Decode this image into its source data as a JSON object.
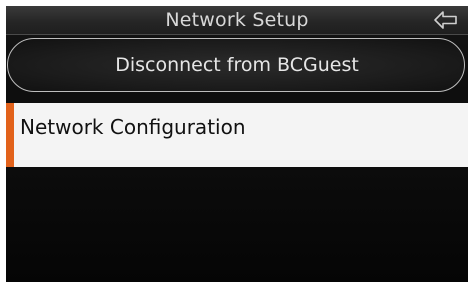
{
  "header": {
    "title": "Network Setup",
    "back_icon": "back-arrow-icon"
  },
  "actions": {
    "disconnect_label": "Disconnect from BCGuest"
  },
  "menu": {
    "items": [
      {
        "label": "Network Configuration",
        "selected": true
      }
    ]
  },
  "colors": {
    "accent": "#e2621b",
    "background": "#0a0a0a",
    "selected_item_bg": "#f4f4f4",
    "text_light": "#e6e6e6"
  }
}
